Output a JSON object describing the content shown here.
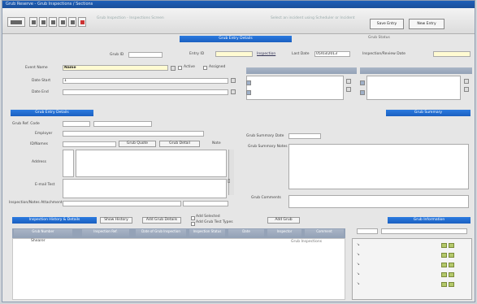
{
  "window": {
    "title": "Grub Reserve - Grub Inspections / Sections"
  },
  "toolbar": {
    "info_line1": "Grub Inspection - Inspections Screen",
    "info_line2": "Select an incident using Scheduler or Incident",
    "btn_save": "Save Entry",
    "btn_cancel": "New Entry"
  },
  "header": {
    "section_title": "Grub Entry Details",
    "grub_status_label": "Grub Status",
    "grub_id_label": "Grub ID",
    "entry_id_label": "Entry ID",
    "entry_id_link": "Inspection",
    "last_date_label": "Last Date",
    "last_date_value": "05/03/2013",
    "inspection_date_label": "Inspection/Review Date"
  },
  "entry": {
    "event_name_label": "Event Name",
    "event_name_value": "Name",
    "status_label": "Active",
    "assigned_label": "Assigned",
    "date_from_label": "Date Start",
    "date_from_value": "1",
    "date_to_label": "Date End"
  },
  "panels": {
    "left_title": "Grub Entry Details",
    "right_title": "Grub Summary",
    "right_col_label": "Grub Summary"
  },
  "grub": {
    "ref_label": "Grub Ref. Code",
    "org_label": "Employer",
    "id_label": "ID/Names",
    "btn_grub": "Grub Quote",
    "btn_grub2": "Grub Detail",
    "address_label": "Address",
    "phone_label": "Phone",
    "email_label": "E-mail Test",
    "notes_label": "Inspection/Notes Attachment",
    "note_label": "Note",
    "summary_date_label": "Grub Summary Date",
    "summary_notes_label": "Grub Summary Notes",
    "summary_extra_label": "Grub Comments"
  },
  "bottom": {
    "left_title": "Inspection History & Details",
    "btn_history": "Show History",
    "btn_add": "Add Grub Details",
    "chk1": "Add Selected",
    "chk2": "Add Grub Test Types",
    "btn_grub": "Add Grub",
    "right_title": "Grub Information",
    "table_headers": [
      "Grub Number",
      "Inspection Ref.",
      "Date of Grub Inspection",
      "Inspection Status",
      "Date",
      "Inspector",
      "Comment"
    ],
    "row0": "Shearer",
    "row0_right": "Grub Inspections"
  }
}
